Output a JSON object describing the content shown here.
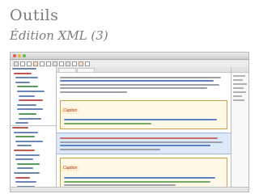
{
  "slide": {
    "title": "Outils",
    "subtitle": "Édition XML (3)"
  },
  "editor": {
    "element_tag_1": "Caption",
    "element_tag_2": "Caption"
  },
  "colors": {
    "tree_blue": "#6d86b8",
    "tree_red": "#c05656",
    "tree_green": "#5a9a5a",
    "element_border": "#c9a34a",
    "selection": "#dde9f9"
  },
  "icons": [
    "close-icon",
    "minimize-icon",
    "maximize-icon",
    "toolbar-icon"
  ]
}
